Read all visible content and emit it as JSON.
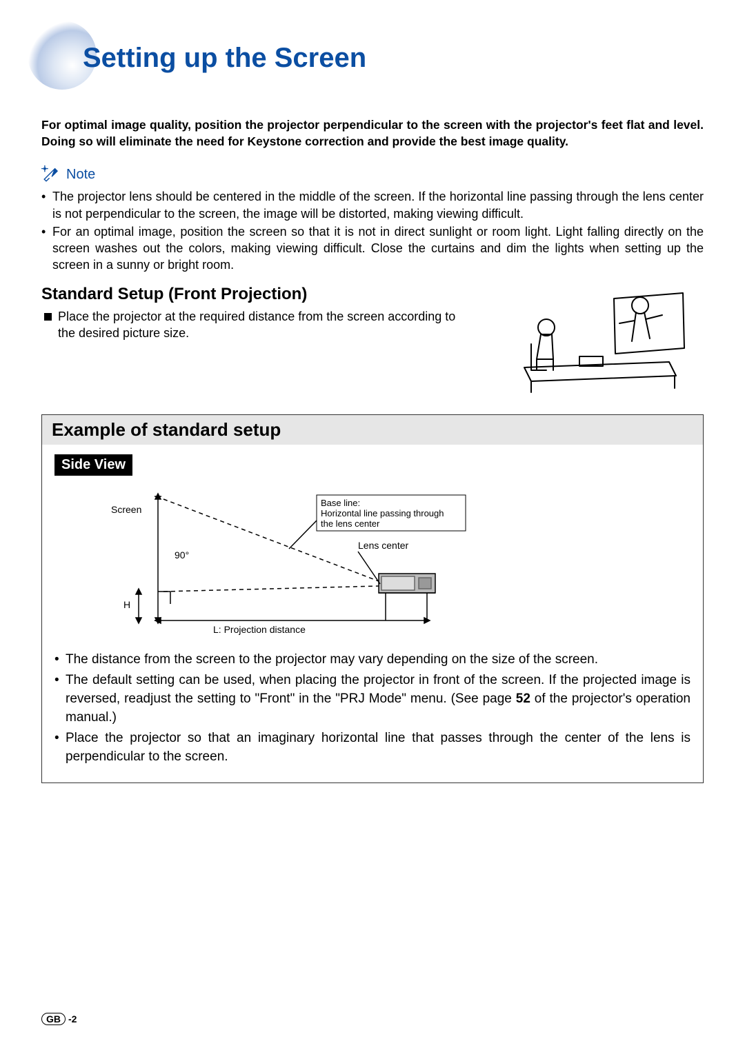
{
  "title": "Setting up the Screen",
  "intro": "For optimal image quality, position the projector perpendicular to the screen with the projector's feet flat and level. Doing so will eliminate the need for Keystone correction and provide the best image quality.",
  "note_label": "Note",
  "note_bullets": [
    "The projector lens should be centered in the middle of the screen. If the horizontal line passing through the lens center is not perpendicular to the screen, the image will be distorted, making viewing difficult.",
    "For an optimal image, position the screen so that it is not in direct sunlight or room light. Light falling directly on the screen washes out the colors, making viewing difficult. Close the curtains and dim the lights when setting up the screen in a sunny or bright room."
  ],
  "standard_setup": {
    "heading": "Standard Setup (Front Projection)",
    "bullet": "Place the projector at the required distance from the screen according to the desired picture size."
  },
  "example_box": {
    "title": "Example of standard setup",
    "side_view_label": "Side View",
    "diagram": {
      "screen_label": "Screen",
      "baseline_label": "Base line:\nHorizontal line passing through\nthe lens center",
      "angle_label": "90°",
      "h_label": "H",
      "lens_center_label": "Lens center",
      "projection_distance_label": "L: Projection distance"
    },
    "bullets": [
      {
        "text": "The distance from the screen to the projector may vary depending on the size of the screen."
      },
      {
        "text_before": "The default setting can be used, when placing the projector in front of the screen. If the projected image is reversed, readjust the setting to \"Front\" in the \"PRJ Mode\" menu. (See page ",
        "page_ref": "52",
        "text_after": " of the projector's operation manual.)"
      },
      {
        "text": "Place the projector so that an imaginary horizontal line that passes through the center of the lens is perpendicular to the screen."
      }
    ]
  },
  "footer": {
    "gb": "GB",
    "page": "-2"
  }
}
